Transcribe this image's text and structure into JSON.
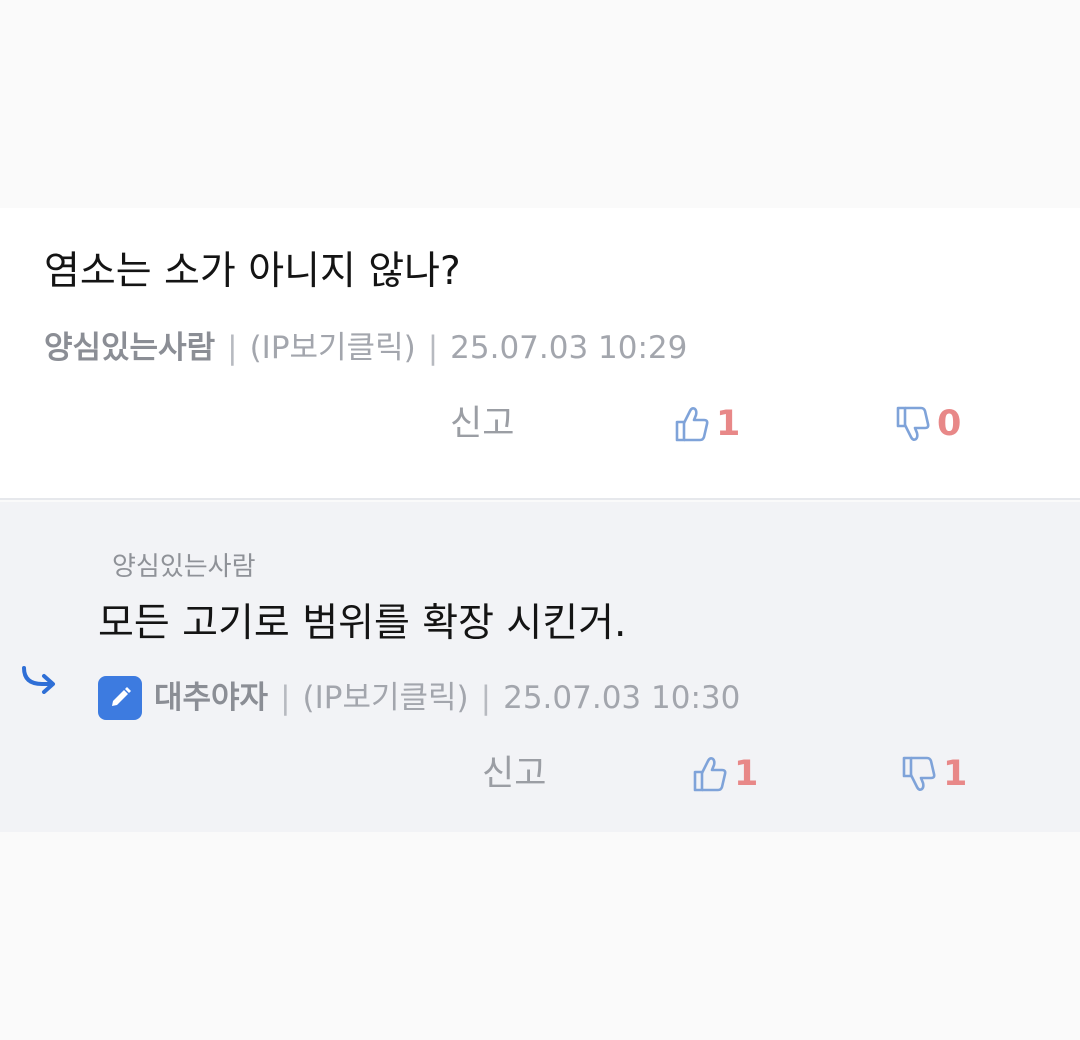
{
  "comments": [
    {
      "body": "염소는 소가 아니지 않나?",
      "author": "양심있는사람",
      "ip_label": "(IP보기클릭)",
      "timestamp": "25.07.03 10:29",
      "report_label": "신고",
      "likes": "1",
      "dislikes": "0"
    }
  ],
  "reply": {
    "parent_author": "양심있는사람",
    "body": "모든 고기로 범위를 확장 시킨거.",
    "author": "대추야자",
    "ip_label": "(IP보기클릭)",
    "timestamp": "25.07.03 10:30",
    "report_label": "신고",
    "likes": "1",
    "dislikes": "1"
  },
  "separator": "|",
  "colors": {
    "icon_blue": "#7fa3d9",
    "count_red": "#e88888",
    "badge_blue": "#3d7be0",
    "reply_arrow": "#2f6fd6"
  },
  "icons": [
    "thumbs-up-icon",
    "thumbs-down-icon",
    "reply-arrow-icon",
    "pencil-icon"
  ]
}
